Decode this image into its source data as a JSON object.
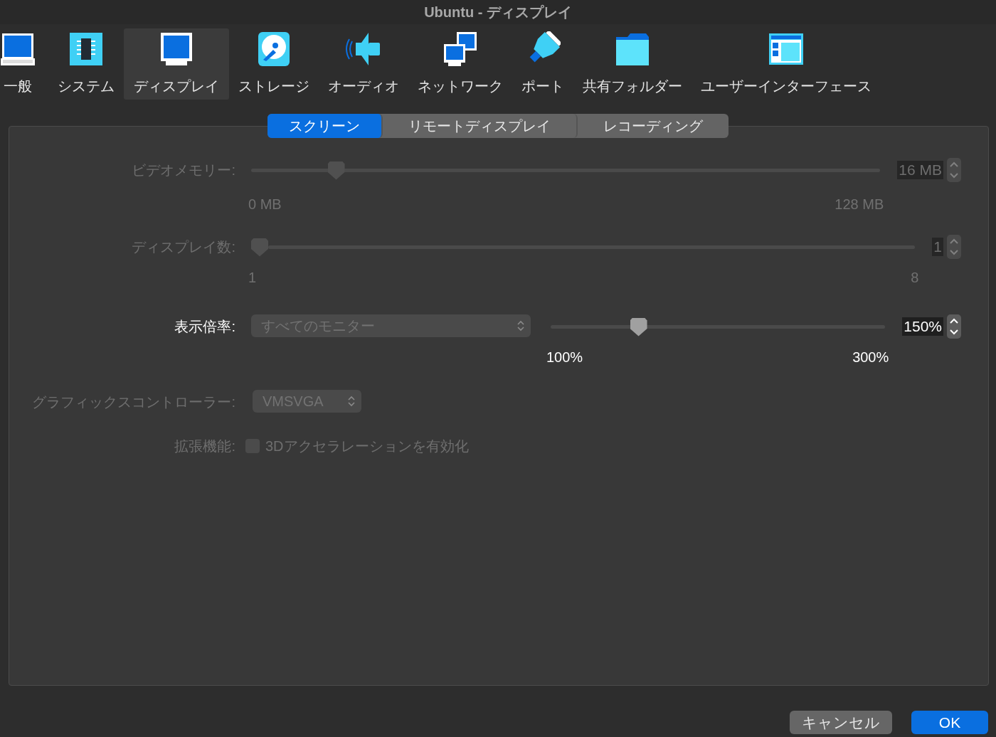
{
  "window": {
    "title": "Ubuntu - ディスプレイ"
  },
  "toolbar": [
    {
      "label": "一般",
      "selected": false
    },
    {
      "label": "システム",
      "selected": false
    },
    {
      "label": "ディスプレイ",
      "selected": true
    },
    {
      "label": "ストレージ",
      "selected": false
    },
    {
      "label": "オーディオ",
      "selected": false
    },
    {
      "label": "ネットワーク",
      "selected": false
    },
    {
      "label": "ポート",
      "selected": false
    },
    {
      "label": "共有フォルダー",
      "selected": false
    },
    {
      "label": "ユーザーインターフェース",
      "selected": false
    }
  ],
  "tabs": [
    {
      "label": "スクリーン",
      "selected": true
    },
    {
      "label": "リモートディスプレイ",
      "selected": false
    },
    {
      "label": "レコーディング",
      "selected": false
    }
  ],
  "settings": [
    {
      "kind": "slider",
      "label": "ビデオメモリー:",
      "disabled": true,
      "level": 0.125,
      "value": "16 MB",
      "min_label": "0 MB",
      "max_label": "128 MB"
    },
    {
      "kind": "slider",
      "label": "ディスプレイ数:",
      "disabled": true,
      "level": 0,
      "value": "1",
      "min_label": "1",
      "max_label": "8"
    },
    {
      "kind": "scale",
      "label": "表示倍率:",
      "disabled": false,
      "dropdown": {
        "value": "すべてのモニター",
        "disabled": true
      },
      "level": 0.25,
      "value": "150%",
      "min_label": "100%",
      "max_label": "300%"
    },
    {
      "kind": "select",
      "label": "グラフィックスコントローラー:",
      "disabled": true,
      "value": "VMSVGA"
    },
    {
      "kind": "checkbox",
      "label": "拡張機能:",
      "disabled": true,
      "checked": false,
      "text": "3Dアクセラレーションを有効化"
    }
  ],
  "buttons": [
    {
      "label": "キャンセル",
      "kind": "secondary"
    },
    {
      "label": "OK",
      "kind": "primary"
    }
  ]
}
